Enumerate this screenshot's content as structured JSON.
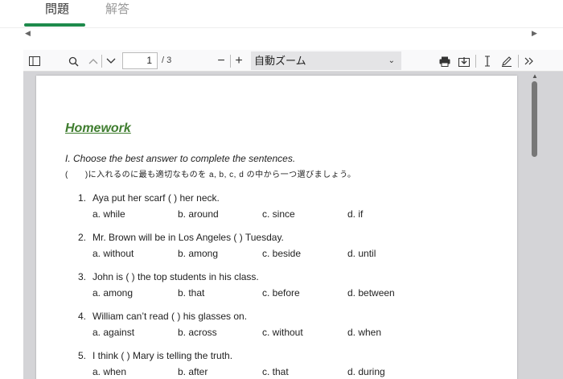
{
  "tabs": [
    {
      "label": "問題"
    },
    {
      "label": "解答"
    }
  ],
  "colors": {
    "accent": "#1e8a4c",
    "title_green": "#3f7d2f",
    "toolbar_bg": "#f9f9fa",
    "viewer_bg": "#d4d4d7"
  },
  "toolbar": {
    "page_current": "1",
    "page_total": "/ 3",
    "zoom_minus": "−",
    "zoom_plus": "+",
    "zoom_label": "自動ズーム",
    "icons": [
      "sidebar-toggle-icon",
      "search-icon",
      "previous-page-icon",
      "next-page-icon",
      "print-icon",
      "download-icon",
      "text-cursor-icon",
      "draw-icon",
      "more-tools-icon"
    ]
  },
  "document": {
    "title": "Homework",
    "instruction": "I. Choose the best answer to complete the sentences.",
    "instruction_jp": "(　　)に入れるのに最も適切なものを a, b, c, d の中から一つ選びましょう。",
    "questions": [
      {
        "num": "1.",
        "text": "Aya put her scarf (           ) her neck.",
        "options": [
          "a. while",
          "b. around",
          "c. since",
          "d. if"
        ]
      },
      {
        "num": "2.",
        "text": "Mr. Brown will be in Los Angeles (         ) Tuesday.",
        "options": [
          "a. without",
          "b. among",
          "c. beside",
          "d. until"
        ]
      },
      {
        "num": "3.",
        "text": "John is (           ) the top students in his class.",
        "options": [
          "a. among",
          "b. that",
          "c. before",
          "d. between"
        ]
      },
      {
        "num": "4.",
        "text": "William can’t read (           ) his glasses on.",
        "options": [
          "a. against",
          "b. across",
          "c. without",
          "d. when"
        ]
      },
      {
        "num": "5.",
        "text": "I think (          ) Mary is telling the truth.",
        "options": [
          "a. when",
          "b. after",
          "c. that",
          "d. during"
        ]
      }
    ]
  }
}
